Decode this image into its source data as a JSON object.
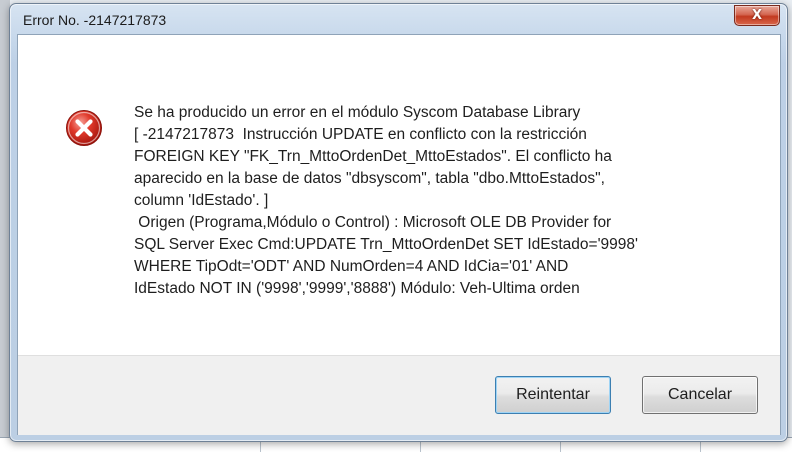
{
  "window": {
    "title": "Error No. -2147217873",
    "close_label": "X"
  },
  "dialog": {
    "icon": "error-icon",
    "message_lines": [
      "Se ha producido un error en el módulo Syscom Database Library",
      "[ -2147217873  Instrucción UPDATE en conflicto con la restricción",
      "FOREIGN KEY \"FK_Trn_MttoOrdenDet_MttoEstados\". El conflicto ha",
      "aparecido en la base de datos \"dbsyscom\", tabla \"dbo.MttoEstados\",",
      "column 'IdEstado'. ]",
      " Origen (Programa,Módulo o Control) : Microsoft OLE DB Provider for",
      "SQL Server Exec Cmd:UPDATE Trn_MttoOrdenDet SET IdEstado='9998'",
      "WHERE TipOdt='ODT' AND NumOrden=4 AND IdCia='01' AND",
      "IdEstado NOT IN ('9998','9999','8888') Módulo: Veh-Ultima orden"
    ],
    "buttons": {
      "retry_label": "Reintentar",
      "cancel_label": "Cancelar"
    }
  },
  "colors": {
    "error_red": "#d0261c",
    "title_gradient_top": "#d7e4f2",
    "close_button_red": "#c2391f"
  }
}
